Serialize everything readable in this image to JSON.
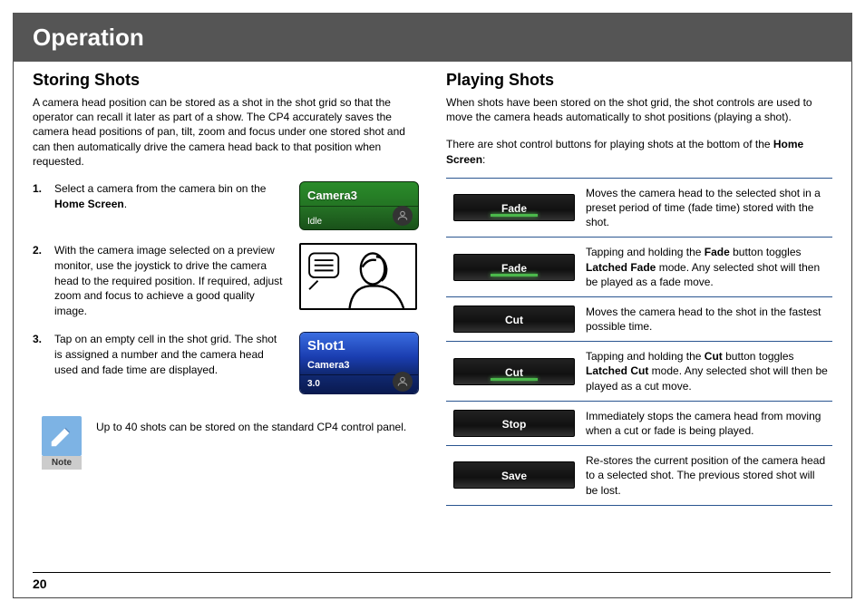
{
  "header": {
    "title": "Operation"
  },
  "page_number": "20",
  "left": {
    "title": "Storing Shots",
    "intro": "A camera head position can be stored as a shot in the shot grid so that the operator can recall it later as part of a show. The CP4 accurately saves the camera head positions of pan, tilt, zoom and focus under one stored shot and can then automatically drive the camera head back to that position when requested.",
    "steps": [
      {
        "num": "1.",
        "text_pre": "Select a camera from the camera bin on the ",
        "bold": "Home Screen",
        "text_post": "."
      },
      {
        "num": "2.",
        "text_pre": "With the camera image selected on a preview monitor, use the joystick to drive the camera head to the required position. If required, adjust zoom and focus to achieve a good quality image.",
        "bold": "",
        "text_post": ""
      },
      {
        "num": "3.",
        "text_pre": "Tap on an empty cell in the shot grid. The shot is assigned a number and the camera head used and fade time are displayed.",
        "bold": "",
        "text_post": ""
      }
    ],
    "camera_fig": {
      "name": "Camera3",
      "status": "Idle"
    },
    "shot_fig": {
      "name": "Shot1",
      "camera": "Camera3",
      "fade": "3.0"
    },
    "note": {
      "label": "Note",
      "text": "Up to 40 shots can be stored on the standard CP4 control panel."
    }
  },
  "right": {
    "title": "Playing Shots",
    "intro": "When shots have been stored on the shot grid, the shot controls are used to move the camera heads automatically to shot positions (playing a shot).",
    "intro2_pre": "There are shot control buttons for playing shots at the bottom of the ",
    "intro2_bold": "Home Screen",
    "intro2_post": ":",
    "rows": [
      {
        "btn": "Fade",
        "desc_pre": "Moves the camera head to the selected shot in a preset period of time (fade time) stored with the shot.",
        "bold": "",
        "desc_post": "",
        "active": true
      },
      {
        "btn": "Fade",
        "desc_pre": "Tapping and holding the ",
        "bold": "Fade",
        "desc_mid": " button toggles ",
        "bold2": "Latched Fade",
        "desc_post": " mode. Any selected shot will then be played as a fade move.",
        "active": true
      },
      {
        "btn": "Cut",
        "desc_pre": "Moves the camera head to the shot in the fastest possible time.",
        "bold": "",
        "desc_post": "",
        "active": false
      },
      {
        "btn": "Cut",
        "desc_pre": "Tapping and holding the ",
        "bold": "Cut",
        "desc_mid": " button toggles ",
        "bold2": "Latched Cut",
        "desc_post": " mode. Any selected shot will then be played as a cut move.",
        "active": true
      },
      {
        "btn": "Stop",
        "desc_pre": "Immediately stops the camera head from moving when a cut or fade is being played.",
        "bold": "",
        "desc_post": "",
        "active": false
      },
      {
        "btn": "Save",
        "desc_pre": "Re-stores the current position of the camera head to a selected shot. The previous stored shot will be lost.",
        "bold": "",
        "desc_post": "",
        "active": false
      }
    ]
  }
}
